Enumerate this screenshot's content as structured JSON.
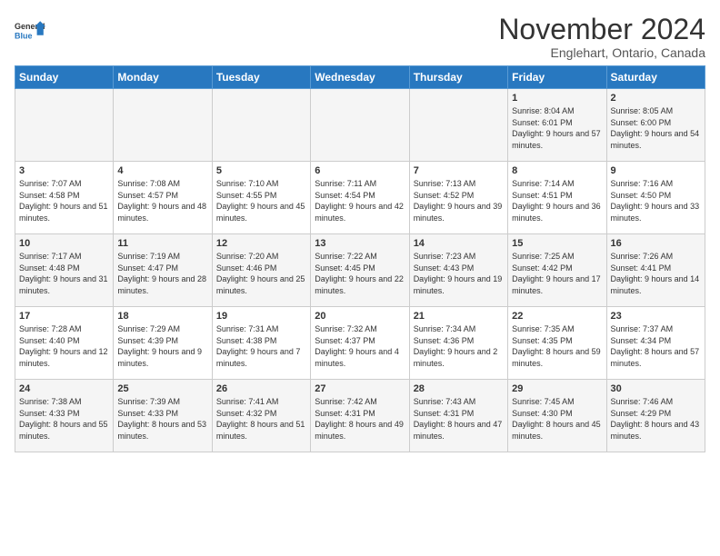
{
  "logo": {
    "line1": "General",
    "line2": "Blue"
  },
  "title": "November 2024",
  "subtitle": "Englehart, Ontario, Canada",
  "headers": [
    "Sunday",
    "Monday",
    "Tuesday",
    "Wednesday",
    "Thursday",
    "Friday",
    "Saturday"
  ],
  "weeks": [
    [
      {
        "day": "",
        "info": ""
      },
      {
        "day": "",
        "info": ""
      },
      {
        "day": "",
        "info": ""
      },
      {
        "day": "",
        "info": ""
      },
      {
        "day": "",
        "info": ""
      },
      {
        "day": "1",
        "info": "Sunrise: 8:04 AM\nSunset: 6:01 PM\nDaylight: 9 hours and 57 minutes."
      },
      {
        "day": "2",
        "info": "Sunrise: 8:05 AM\nSunset: 6:00 PM\nDaylight: 9 hours and 54 minutes."
      }
    ],
    [
      {
        "day": "3",
        "info": "Sunrise: 7:07 AM\nSunset: 4:58 PM\nDaylight: 9 hours and 51 minutes."
      },
      {
        "day": "4",
        "info": "Sunrise: 7:08 AM\nSunset: 4:57 PM\nDaylight: 9 hours and 48 minutes."
      },
      {
        "day": "5",
        "info": "Sunrise: 7:10 AM\nSunset: 4:55 PM\nDaylight: 9 hours and 45 minutes."
      },
      {
        "day": "6",
        "info": "Sunrise: 7:11 AM\nSunset: 4:54 PM\nDaylight: 9 hours and 42 minutes."
      },
      {
        "day": "7",
        "info": "Sunrise: 7:13 AM\nSunset: 4:52 PM\nDaylight: 9 hours and 39 minutes."
      },
      {
        "day": "8",
        "info": "Sunrise: 7:14 AM\nSunset: 4:51 PM\nDaylight: 9 hours and 36 minutes."
      },
      {
        "day": "9",
        "info": "Sunrise: 7:16 AM\nSunset: 4:50 PM\nDaylight: 9 hours and 33 minutes."
      }
    ],
    [
      {
        "day": "10",
        "info": "Sunrise: 7:17 AM\nSunset: 4:48 PM\nDaylight: 9 hours and 31 minutes."
      },
      {
        "day": "11",
        "info": "Sunrise: 7:19 AM\nSunset: 4:47 PM\nDaylight: 9 hours and 28 minutes."
      },
      {
        "day": "12",
        "info": "Sunrise: 7:20 AM\nSunset: 4:46 PM\nDaylight: 9 hours and 25 minutes."
      },
      {
        "day": "13",
        "info": "Sunrise: 7:22 AM\nSunset: 4:45 PM\nDaylight: 9 hours and 22 minutes."
      },
      {
        "day": "14",
        "info": "Sunrise: 7:23 AM\nSunset: 4:43 PM\nDaylight: 9 hours and 19 minutes."
      },
      {
        "day": "15",
        "info": "Sunrise: 7:25 AM\nSunset: 4:42 PM\nDaylight: 9 hours and 17 minutes."
      },
      {
        "day": "16",
        "info": "Sunrise: 7:26 AM\nSunset: 4:41 PM\nDaylight: 9 hours and 14 minutes."
      }
    ],
    [
      {
        "day": "17",
        "info": "Sunrise: 7:28 AM\nSunset: 4:40 PM\nDaylight: 9 hours and 12 minutes."
      },
      {
        "day": "18",
        "info": "Sunrise: 7:29 AM\nSunset: 4:39 PM\nDaylight: 9 hours and 9 minutes."
      },
      {
        "day": "19",
        "info": "Sunrise: 7:31 AM\nSunset: 4:38 PM\nDaylight: 9 hours and 7 minutes."
      },
      {
        "day": "20",
        "info": "Sunrise: 7:32 AM\nSunset: 4:37 PM\nDaylight: 9 hours and 4 minutes."
      },
      {
        "day": "21",
        "info": "Sunrise: 7:34 AM\nSunset: 4:36 PM\nDaylight: 9 hours and 2 minutes."
      },
      {
        "day": "22",
        "info": "Sunrise: 7:35 AM\nSunset: 4:35 PM\nDaylight: 8 hours and 59 minutes."
      },
      {
        "day": "23",
        "info": "Sunrise: 7:37 AM\nSunset: 4:34 PM\nDaylight: 8 hours and 57 minutes."
      }
    ],
    [
      {
        "day": "24",
        "info": "Sunrise: 7:38 AM\nSunset: 4:33 PM\nDaylight: 8 hours and 55 minutes."
      },
      {
        "day": "25",
        "info": "Sunrise: 7:39 AM\nSunset: 4:33 PM\nDaylight: 8 hours and 53 minutes."
      },
      {
        "day": "26",
        "info": "Sunrise: 7:41 AM\nSunset: 4:32 PM\nDaylight: 8 hours and 51 minutes."
      },
      {
        "day": "27",
        "info": "Sunrise: 7:42 AM\nSunset: 4:31 PM\nDaylight: 8 hours and 49 minutes."
      },
      {
        "day": "28",
        "info": "Sunrise: 7:43 AM\nSunset: 4:31 PM\nDaylight: 8 hours and 47 minutes."
      },
      {
        "day": "29",
        "info": "Sunrise: 7:45 AM\nSunset: 4:30 PM\nDaylight: 8 hours and 45 minutes."
      },
      {
        "day": "30",
        "info": "Sunrise: 7:46 AM\nSunset: 4:29 PM\nDaylight: 8 hours and 43 minutes."
      }
    ]
  ]
}
